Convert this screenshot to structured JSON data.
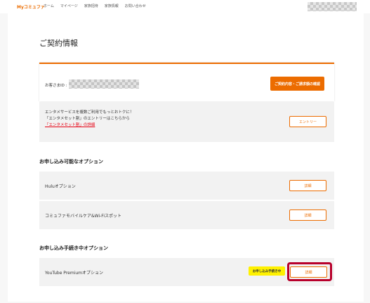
{
  "header": {
    "logo": "Myコミュファ",
    "nav": [
      "ホーム",
      "マイページ",
      "家族招待",
      "家族情報",
      "お問い合わせ"
    ]
  },
  "page": {
    "title": "ご契約情報"
  },
  "contract": {
    "customer_label": "お客さまID :",
    "button_label": "ご契約内容・ご請求額の確認"
  },
  "entame": {
    "line1": "エンタメサービスを複数ご利用でもっとおトクに！",
    "line2": "「エンタメセット割」のエントリーはこちらから",
    "link": "「エンタメセット割」の詳細",
    "button_label": "エントリー"
  },
  "available": {
    "heading": "お申し込み可能なオプション",
    "items": [
      {
        "label": "Huluオプション",
        "button": "詳細"
      },
      {
        "label": "コミュファモバイルケア&Wi-Fiスポット",
        "button": "詳細"
      }
    ]
  },
  "pending": {
    "heading": "お申し込み手続き中オプション",
    "items": [
      {
        "label": "YouTube Premiumオプション",
        "badge": "お申し込み手続き中",
        "button": "詳細"
      }
    ]
  },
  "colors": {
    "accent": "#ec6c00",
    "badge": "#fff100",
    "highlight": "#b8002b",
    "link": "#e60012"
  }
}
